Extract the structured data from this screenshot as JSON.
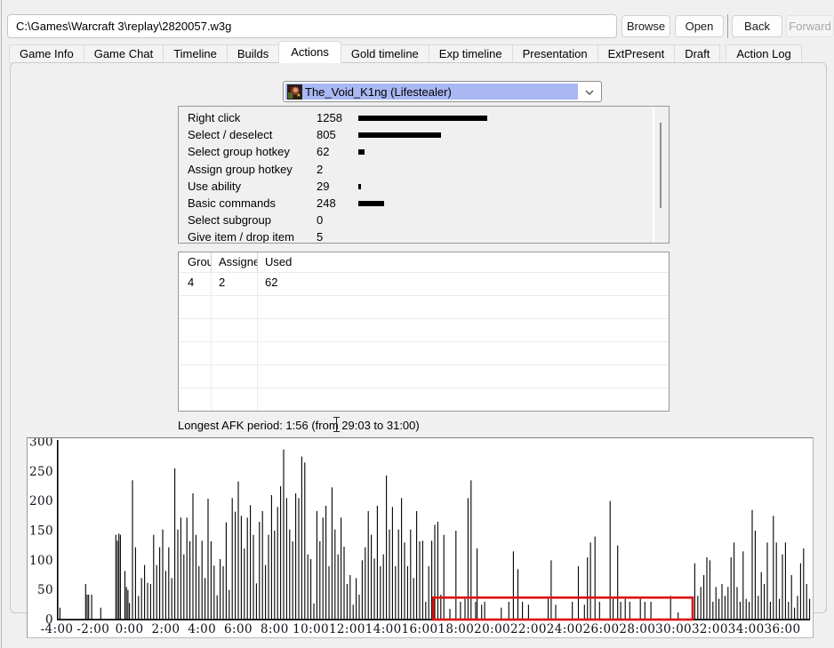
{
  "window": {
    "address": {
      "value": "C:\\Games\\Warcraft 3\\replay\\2820057.w3g"
    },
    "buttons": {
      "browse": "Browse",
      "open": "Open",
      "back": "Back",
      "forward": "Forward"
    }
  },
  "tabs": {
    "active": "Actions",
    "items": [
      "Game Info",
      "Game Chat",
      "Timeline",
      "Builds",
      "Actions",
      "Gold timeline",
      "Exp timeline",
      "Presentation",
      "ExtPresent",
      "Draft",
      "Action Log"
    ]
  },
  "player_select": {
    "value": "The_Void_K1ng (Lifestealer)"
  },
  "action_stats": {
    "rows": [
      {
        "label": "Right click",
        "value": 1258
      },
      {
        "label": "Select / deselect",
        "value": 805
      },
      {
        "label": "Select group hotkey",
        "value": 62
      },
      {
        "label": "Assign group hotkey",
        "value": 2
      },
      {
        "label": "Use ability",
        "value": 29
      },
      {
        "label": "Basic commands",
        "value": 248
      },
      {
        "label": "Select subgroup",
        "value": 0
      },
      {
        "label": "Give item / drop item",
        "value": 5
      }
    ]
  },
  "hotkey_table": {
    "columns": [
      "Group",
      "Assigned",
      "Used"
    ],
    "rows": [
      [
        "4",
        "2",
        "62"
      ]
    ],
    "empty_rows": 5
  },
  "afk_note": "Longest AFK period: 1:56 (from 29:03 to 31:00)",
  "chart_data": {
    "type": "bar",
    "description": "Actions over game time, one bar per 10-second interval",
    "y_axis": {
      "ticks": [
        0,
        50,
        100,
        150,
        200,
        250,
        300
      ],
      "max": 300
    },
    "x_axis": {
      "tick_minutes": [
        -4,
        -2,
        0,
        2,
        4,
        6,
        8,
        10,
        12,
        14,
        16,
        18,
        20,
        22,
        24,
        26,
        28,
        30,
        32,
        34,
        36
      ],
      "tick_labels": [
        "-4:00",
        "-2:00",
        "0:00",
        "2:00",
        "4:00",
        "6:00",
        "8:00",
        "10:00",
        "12:00",
        "14:00",
        "16:00",
        "18:00",
        "20:00",
        "22:00",
        "24:00",
        "26:00",
        "28:00",
        "30:00",
        "32:00",
        "34:00",
        "36:00"
      ]
    },
    "bar_interval_seconds": 10,
    "afk_highlight": {
      "from_label": "29:03",
      "to_label": "31:00",
      "box_start_min": 16.75,
      "box_end_min": 31.05,
      "box_top_value": 37,
      "color": "#dd1412"
    },
    "bars": [
      [
        -230,
        20
      ],
      [
        -145,
        60
      ],
      [
        -140,
        42
      ],
      [
        -135,
        42
      ],
      [
        -125,
        42
      ],
      [
        -95,
        20
      ],
      [
        -45,
        143
      ],
      [
        -40,
        133
      ],
      [
        -35,
        145
      ],
      [
        -30,
        143
      ],
      [
        -15,
        82
      ],
      [
        -10,
        55
      ],
      [
        -5,
        50
      ],
      [
        0,
        28
      ],
      [
        10,
        235
      ],
      [
        20,
        122
      ],
      [
        30,
        40
      ],
      [
        40,
        70
      ],
      [
        50,
        92
      ],
      [
        60,
        62
      ],
      [
        70,
        60
      ],
      [
        80,
        143
      ],
      [
        90,
        92
      ],
      [
        100,
        122
      ],
      [
        110,
        152
      ],
      [
        120,
        82
      ],
      [
        130,
        122
      ],
      [
        140,
        70
      ],
      [
        150,
        255
      ],
      [
        160,
        152
      ],
      [
        170,
        172
      ],
      [
        180,
        110
      ],
      [
        190,
        172
      ],
      [
        200,
        132
      ],
      [
        210,
        213
      ],
      [
        220,
        143
      ],
      [
        230,
        90
      ],
      [
        240,
        133
      ],
      [
        250,
        70
      ],
      [
        260,
        204
      ],
      [
        270,
        132
      ],
      [
        280,
        91
      ],
      [
        290,
        41
      ],
      [
        300,
        102
      ],
      [
        310,
        90
      ],
      [
        320,
        164
      ],
      [
        330,
        50
      ],
      [
        340,
        205
      ],
      [
        350,
        182
      ],
      [
        360,
        233
      ],
      [
        370,
        175
      ],
      [
        380,
        120
      ],
      [
        390,
        172
      ],
      [
        400,
        193
      ],
      [
        410,
        143
      ],
      [
        420,
        61
      ],
      [
        430,
        165
      ],
      [
        440,
        183
      ],
      [
        450,
        92
      ],
      [
        460,
        143
      ],
      [
        470,
        210
      ],
      [
        480,
        150
      ],
      [
        490,
        190
      ],
      [
        500,
        225
      ],
      [
        510,
        287
      ],
      [
        520,
        205
      ],
      [
        530,
        152
      ],
      [
        540,
        132
      ],
      [
        550,
        213
      ],
      [
        560,
        205
      ],
      [
        570,
        275
      ],
      [
        580,
        265
      ],
      [
        590,
        110
      ],
      [
        600,
        102
      ],
      [
        610,
        27
      ],
      [
        620,
        183
      ],
      [
        630,
        132
      ],
      [
        640,
        172
      ],
      [
        650,
        192
      ],
      [
        660,
        90
      ],
      [
        670,
        223
      ],
      [
        680,
        152
      ],
      [
        690,
        110
      ],
      [
        700,
        172
      ],
      [
        710,
        123
      ],
      [
        720,
        60
      ],
      [
        730,
        75
      ],
      [
        740,
        25
      ],
      [
        750,
        70
      ],
      [
        760,
        42
      ],
      [
        770,
        100
      ],
      [
        780,
        122
      ],
      [
        790,
        183
      ],
      [
        800,
        143
      ],
      [
        810,
        103
      ],
      [
        820,
        192
      ],
      [
        830,
        90
      ],
      [
        840,
        110
      ],
      [
        850,
        243
      ],
      [
        860,
        152
      ],
      [
        870,
        190
      ],
      [
        880,
        90
      ],
      [
        890,
        152
      ],
      [
        900,
        205
      ],
      [
        910,
        130
      ],
      [
        920,
        90
      ],
      [
        930,
        152
      ],
      [
        940,
        70
      ],
      [
        950,
        183
      ],
      [
        960,
        132
      ],
      [
        970,
        133
      ],
      [
        980,
        30
      ],
      [
        990,
        90
      ],
      [
        1000,
        133
      ],
      [
        1010,
        160
      ],
      [
        1020,
        165
      ],
      [
        1030,
        42
      ],
      [
        1040,
        143
      ],
      [
        1060,
        18
      ],
      [
        1080,
        150
      ],
      [
        1095,
        30
      ],
      [
        1110,
        35
      ],
      [
        1120,
        205
      ],
      [
        1130,
        235
      ],
      [
        1145,
        30
      ],
      [
        1150,
        120
      ],
      [
        1165,
        25
      ],
      [
        1175,
        30
      ],
      [
        1230,
        20
      ],
      [
        1255,
        30
      ],
      [
        1270,
        115
      ],
      [
        1285,
        85
      ],
      [
        1300,
        30
      ],
      [
        1320,
        25
      ],
      [
        1385,
        35
      ],
      [
        1395,
        100
      ],
      [
        1410,
        25
      ],
      [
        1465,
        30
      ],
      [
        1485,
        90
      ],
      [
        1505,
        25
      ],
      [
        1515,
        105
      ],
      [
        1525,
        130
      ],
      [
        1540,
        140
      ],
      [
        1555,
        30
      ],
      [
        1590,
        200
      ],
      [
        1600,
        35
      ],
      [
        1615,
        125
      ],
      [
        1625,
        30
      ],
      [
        1640,
        35
      ],
      [
        1655,
        30
      ],
      [
        1690,
        35
      ],
      [
        1705,
        30
      ],
      [
        1725,
        30
      ],
      [
        1790,
        40
      ],
      [
        1815,
        12
      ],
      [
        1870,
        95
      ],
      [
        1880,
        40
      ],
      [
        1890,
        55
      ],
      [
        1900,
        75
      ],
      [
        1910,
        105
      ],
      [
        1920,
        100
      ],
      [
        1930,
        30
      ],
      [
        1940,
        55
      ],
      [
        1950,
        35
      ],
      [
        1960,
        60
      ],
      [
        1970,
        40
      ],
      [
        1980,
        55
      ],
      [
        1990,
        105
      ],
      [
        2000,
        130
      ],
      [
        2010,
        55
      ],
      [
        2020,
        30
      ],
      [
        2030,
        115
      ],
      [
        2040,
        35
      ],
      [
        2050,
        30
      ],
      [
        2060,
        185
      ],
      [
        2070,
        150
      ],
      [
        2080,
        40
      ],
      [
        2090,
        80
      ],
      [
        2100,
        60
      ],
      [
        2110,
        130
      ],
      [
        2120,
        30
      ],
      [
        2130,
        175
      ],
      [
        2140,
        130
      ],
      [
        2150,
        35
      ],
      [
        2160,
        110
      ],
      [
        2170,
        130
      ],
      [
        2180,
        30
      ],
      [
        2190,
        75
      ],
      [
        2200,
        20
      ],
      [
        2210,
        40
      ],
      [
        2220,
        95
      ],
      [
        2230,
        120
      ],
      [
        2240,
        60
      ],
      [
        2250,
        35
      ]
    ]
  }
}
